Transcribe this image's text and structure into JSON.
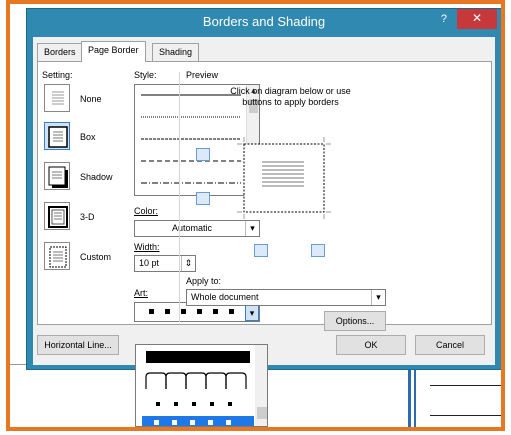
{
  "dialog": {
    "title": "Borders and Shading",
    "close_glyph": "✕",
    "help_glyph": "?"
  },
  "tabs": [
    {
      "label": "Borders",
      "active": false
    },
    {
      "label": "Page Border",
      "active": true
    },
    {
      "label": "Shading",
      "active": false
    }
  ],
  "setting": {
    "header": "Setting:",
    "items": [
      {
        "label": "None",
        "icon": "none-setting-icon",
        "selected": false
      },
      {
        "label": "Box",
        "icon": "box-setting-icon",
        "selected": true
      },
      {
        "label": "Shadow",
        "icon": "shadow-setting-icon",
        "selected": false
      },
      {
        "label": "3-D",
        "icon": "3d-setting-icon",
        "selected": false
      },
      {
        "label": "Custom",
        "icon": "custom-setting-icon",
        "selected": false
      }
    ]
  },
  "style": {
    "header": "Style:",
    "items": [
      "solid",
      "dotted",
      "dashed-small",
      "dashed",
      "dash-dot"
    ]
  },
  "color": {
    "label": "Color:",
    "value": "Automatic"
  },
  "width": {
    "label": "Width:",
    "value": "10 pt"
  },
  "art": {
    "label": "Art:",
    "options": [
      "black-squares",
      "solid-bar",
      "arches",
      "dots",
      "white-squares-selected"
    ]
  },
  "preview": {
    "header": "Preview",
    "hint": "Click on diagram below or use buttons to apply borders"
  },
  "apply_to": {
    "label": "Apply to:",
    "value": "Whole document"
  },
  "buttons": {
    "options": "Options...",
    "horizontal_line": "Horizontal Line...",
    "ok": "OK",
    "cancel": "Cancel"
  },
  "colors": {
    "frame": "#e87722",
    "titlebar": "#2f89b0",
    "close": "#c7383b",
    "selection": "#1e78e6"
  }
}
